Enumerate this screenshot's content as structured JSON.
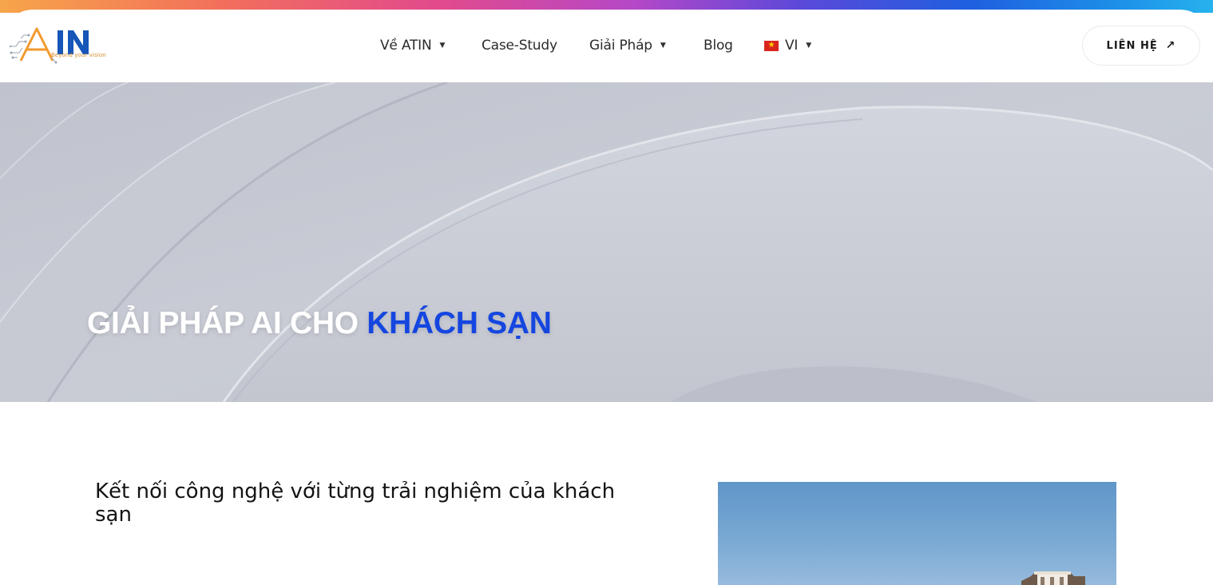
{
  "brand": {
    "logo_text": "ATIN",
    "tagline": "Beyond your vision",
    "colors": {
      "orange": "#f29a2e",
      "blue": "#1556b8"
    }
  },
  "nav": {
    "items": [
      {
        "label": "Về ATIN",
        "has_dropdown": true
      },
      {
        "label": "Case-Study",
        "has_dropdown": false
      },
      {
        "label": "Giải Pháp",
        "has_dropdown": true
      },
      {
        "label": "Blog",
        "has_dropdown": false
      }
    ],
    "language": {
      "label": "VI",
      "flag_icon": "vietnam-flag-icon",
      "has_dropdown": true
    }
  },
  "header": {
    "contact_label": "LIÊN HỆ",
    "contact_icon": "arrow-up-right-icon"
  },
  "hero": {
    "title_prefix": "GIẢI PHÁP AI CHO",
    "title_highlight": "KHÁCH SẠN",
    "highlight_color": "#1546e0"
  },
  "section": {
    "heading": "Kết nối công nghệ với từng trải nghiệm của khách sạn"
  },
  "theme": {
    "top_gradient": [
      "#f7a54a",
      "#e24a8c",
      "#5b49d9",
      "#27b2ee"
    ],
    "hero_background": "#c5c8d1"
  }
}
